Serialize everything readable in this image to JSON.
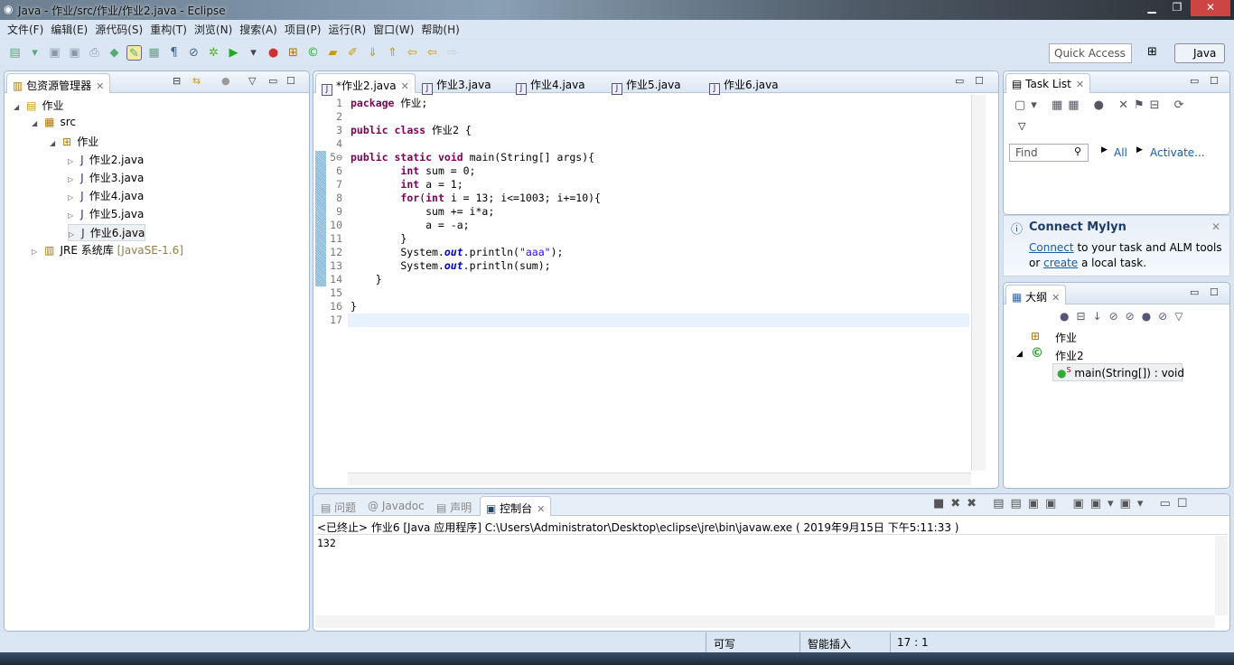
{
  "window": {
    "title": "Java  -  作业/src/作业/作业2.java  -  Eclipse",
    "min": "▁",
    "max": "❐",
    "close": "✕"
  },
  "menu": [
    "文件(F)",
    "编辑(E)",
    "源代码(S)",
    "重构(T)",
    "浏览(N)",
    "搜索(A)",
    "项目(P)",
    "运行(R)",
    "窗口(W)",
    "帮助(H)"
  ],
  "toolbar": {
    "quick_access": "Quick Access",
    "perspective": "Java"
  },
  "package_explorer": {
    "title": "包资源管理器",
    "tree": [
      {
        "label": "作业",
        "level": 0,
        "icon": "project-icon",
        "expanded": true
      },
      {
        "label": "src",
        "level": 1,
        "icon": "source-folder-icon",
        "expanded": true
      },
      {
        "label": "作业",
        "level": 2,
        "icon": "package-icon",
        "expanded": true
      },
      {
        "label": "作业2.java",
        "level": 3,
        "icon": "java-file-icon"
      },
      {
        "label": "作业3.java",
        "level": 3,
        "icon": "java-file-icon"
      },
      {
        "label": "作业4.java",
        "level": 3,
        "icon": "java-file-icon"
      },
      {
        "label": "作业5.java",
        "level": 3,
        "icon": "java-file-icon"
      },
      {
        "label": "作业6.java",
        "level": 3,
        "icon": "java-file-icon",
        "selected": true
      },
      {
        "label": "JRE 系统库",
        "suffix": "[JavaSE-1.6]",
        "level": 1,
        "icon": "library-icon"
      }
    ]
  },
  "editor": {
    "tabs": [
      "*作业2.java",
      "作业3.java",
      "作业4.java",
      "作业5.java",
      "作业6.java"
    ],
    "active_tab": 0,
    "lines": [
      "package 作业;",
      "",
      "public class 作业2 {",
      "",
      "public static void main(String[] args){",
      "        int sum = 0;",
      "        int a = 1;",
      "        for(int i = 13; i<=1003; i+=10){",
      "            sum += i*a;",
      "            a = -a;",
      "        }",
      "        System.out.println(\"aaa\");",
      "        System.out.println(sum);",
      "    }",
      "",
      "}",
      ""
    ]
  },
  "task_list": {
    "title": "Task List",
    "find_placeholder": "Find",
    "all": "All",
    "activate": "Activate..."
  },
  "mylyn": {
    "title": "Connect Mylyn",
    "connect": "Connect",
    "text1": " to your task and ALM tools",
    "or": "or ",
    "create": "create",
    "text2": " a local task."
  },
  "outline": {
    "title": "大纲",
    "items": [
      "作业",
      "作业2",
      "main(String[]) : void"
    ],
    "static_marker": "S"
  },
  "console": {
    "tabs": [
      "问题",
      "Javadoc",
      "声明",
      "控制台"
    ],
    "header": "<已终止> 作业6 [Java 应用程序] C:\\Users\\Administrator\\Desktop\\eclipse\\jre\\bin\\javaw.exe ( 2019年9月15日 下午5:11:33 )",
    "output": "132"
  },
  "status": {
    "writable": "可写",
    "insert_mode": "智能插入",
    "position": "17 : 1"
  }
}
